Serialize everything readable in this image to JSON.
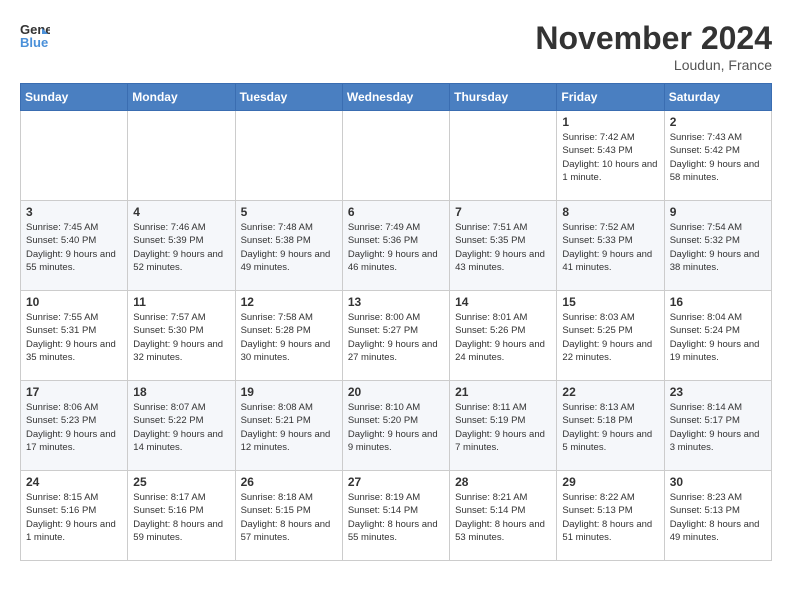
{
  "header": {
    "logo_line1": "General",
    "logo_line2": "Blue",
    "month": "November 2024",
    "location": "Loudun, France"
  },
  "days_of_week": [
    "Sunday",
    "Monday",
    "Tuesday",
    "Wednesday",
    "Thursday",
    "Friday",
    "Saturday"
  ],
  "weeks": [
    [
      {
        "day": "",
        "info": ""
      },
      {
        "day": "",
        "info": ""
      },
      {
        "day": "",
        "info": ""
      },
      {
        "day": "",
        "info": ""
      },
      {
        "day": "",
        "info": ""
      },
      {
        "day": "1",
        "info": "Sunrise: 7:42 AM\nSunset: 5:43 PM\nDaylight: 10 hours and 1 minute."
      },
      {
        "day": "2",
        "info": "Sunrise: 7:43 AM\nSunset: 5:42 PM\nDaylight: 9 hours and 58 minutes."
      }
    ],
    [
      {
        "day": "3",
        "info": "Sunrise: 7:45 AM\nSunset: 5:40 PM\nDaylight: 9 hours and 55 minutes."
      },
      {
        "day": "4",
        "info": "Sunrise: 7:46 AM\nSunset: 5:39 PM\nDaylight: 9 hours and 52 minutes."
      },
      {
        "day": "5",
        "info": "Sunrise: 7:48 AM\nSunset: 5:38 PM\nDaylight: 9 hours and 49 minutes."
      },
      {
        "day": "6",
        "info": "Sunrise: 7:49 AM\nSunset: 5:36 PM\nDaylight: 9 hours and 46 minutes."
      },
      {
        "day": "7",
        "info": "Sunrise: 7:51 AM\nSunset: 5:35 PM\nDaylight: 9 hours and 43 minutes."
      },
      {
        "day": "8",
        "info": "Sunrise: 7:52 AM\nSunset: 5:33 PM\nDaylight: 9 hours and 41 minutes."
      },
      {
        "day": "9",
        "info": "Sunrise: 7:54 AM\nSunset: 5:32 PM\nDaylight: 9 hours and 38 minutes."
      }
    ],
    [
      {
        "day": "10",
        "info": "Sunrise: 7:55 AM\nSunset: 5:31 PM\nDaylight: 9 hours and 35 minutes."
      },
      {
        "day": "11",
        "info": "Sunrise: 7:57 AM\nSunset: 5:30 PM\nDaylight: 9 hours and 32 minutes."
      },
      {
        "day": "12",
        "info": "Sunrise: 7:58 AM\nSunset: 5:28 PM\nDaylight: 9 hours and 30 minutes."
      },
      {
        "day": "13",
        "info": "Sunrise: 8:00 AM\nSunset: 5:27 PM\nDaylight: 9 hours and 27 minutes."
      },
      {
        "day": "14",
        "info": "Sunrise: 8:01 AM\nSunset: 5:26 PM\nDaylight: 9 hours and 24 minutes."
      },
      {
        "day": "15",
        "info": "Sunrise: 8:03 AM\nSunset: 5:25 PM\nDaylight: 9 hours and 22 minutes."
      },
      {
        "day": "16",
        "info": "Sunrise: 8:04 AM\nSunset: 5:24 PM\nDaylight: 9 hours and 19 minutes."
      }
    ],
    [
      {
        "day": "17",
        "info": "Sunrise: 8:06 AM\nSunset: 5:23 PM\nDaylight: 9 hours and 17 minutes."
      },
      {
        "day": "18",
        "info": "Sunrise: 8:07 AM\nSunset: 5:22 PM\nDaylight: 9 hours and 14 minutes."
      },
      {
        "day": "19",
        "info": "Sunrise: 8:08 AM\nSunset: 5:21 PM\nDaylight: 9 hours and 12 minutes."
      },
      {
        "day": "20",
        "info": "Sunrise: 8:10 AM\nSunset: 5:20 PM\nDaylight: 9 hours and 9 minutes."
      },
      {
        "day": "21",
        "info": "Sunrise: 8:11 AM\nSunset: 5:19 PM\nDaylight: 9 hours and 7 minutes."
      },
      {
        "day": "22",
        "info": "Sunrise: 8:13 AM\nSunset: 5:18 PM\nDaylight: 9 hours and 5 minutes."
      },
      {
        "day": "23",
        "info": "Sunrise: 8:14 AM\nSunset: 5:17 PM\nDaylight: 9 hours and 3 minutes."
      }
    ],
    [
      {
        "day": "24",
        "info": "Sunrise: 8:15 AM\nSunset: 5:16 PM\nDaylight: 9 hours and 1 minute."
      },
      {
        "day": "25",
        "info": "Sunrise: 8:17 AM\nSunset: 5:16 PM\nDaylight: 8 hours and 59 minutes."
      },
      {
        "day": "26",
        "info": "Sunrise: 8:18 AM\nSunset: 5:15 PM\nDaylight: 8 hours and 57 minutes."
      },
      {
        "day": "27",
        "info": "Sunrise: 8:19 AM\nSunset: 5:14 PM\nDaylight: 8 hours and 55 minutes."
      },
      {
        "day": "28",
        "info": "Sunrise: 8:21 AM\nSunset: 5:14 PM\nDaylight: 8 hours and 53 minutes."
      },
      {
        "day": "29",
        "info": "Sunrise: 8:22 AM\nSunset: 5:13 PM\nDaylight: 8 hours and 51 minutes."
      },
      {
        "day": "30",
        "info": "Sunrise: 8:23 AM\nSunset: 5:13 PM\nDaylight: 8 hours and 49 minutes."
      }
    ]
  ]
}
